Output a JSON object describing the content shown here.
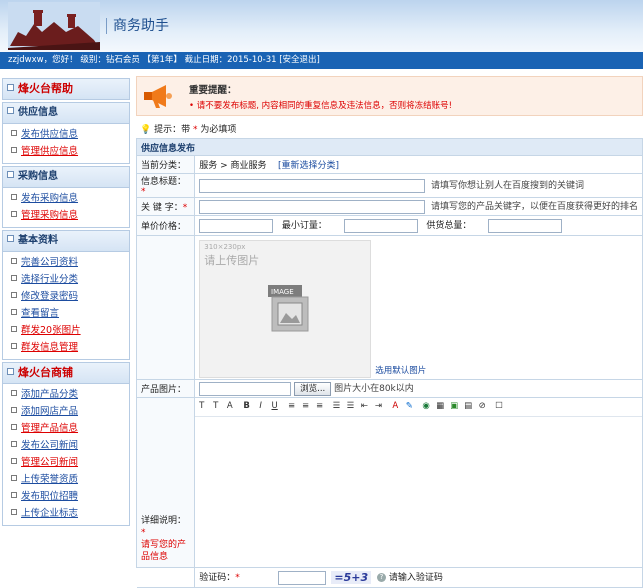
{
  "header": {
    "app_title": "商务助手"
  },
  "userbar": {
    "text": "zzjdwxw，您好！ 级别：钻石会员 【第1年】 截止日期：2015-10-31 [安全退出]"
  },
  "sidebar": {
    "sections": [
      {
        "title": "烽火台帮助",
        "style": "red",
        "items": []
      },
      {
        "title": "供应信息",
        "style": "blue",
        "items": [
          {
            "label": "发布供应信息",
            "red": false
          },
          {
            "label": "管理供应信息",
            "red": true
          }
        ]
      },
      {
        "title": "采购信息",
        "style": "blue",
        "items": [
          {
            "label": "发布采购信息",
            "red": false
          },
          {
            "label": "管理采购信息",
            "red": true
          }
        ]
      },
      {
        "title": "基本资料",
        "style": "blue",
        "items": [
          {
            "label": "完善公司资料",
            "red": false
          },
          {
            "label": "选择行业分类",
            "red": false
          },
          {
            "label": "修改登录密码",
            "red": false
          },
          {
            "label": "查看留言",
            "red": false
          },
          {
            "label": "群发20张图片",
            "red": true
          },
          {
            "label": "群发信息管理",
            "red": true
          }
        ]
      },
      {
        "title": "烽火台商铺",
        "style": "red",
        "items": [
          {
            "label": "添加产品分类",
            "red": false
          },
          {
            "label": "添加网店产品",
            "red": false
          },
          {
            "label": "管理产品信息",
            "red": true
          },
          {
            "label": "发布公司新闻",
            "red": false
          },
          {
            "label": "管理公司新闻",
            "red": true
          },
          {
            "label": "上传荣誉资质",
            "red": false
          },
          {
            "label": "发布职位招聘",
            "red": false
          },
          {
            "label": "上传企业标志",
            "red": false
          }
        ]
      }
    ]
  },
  "notice": {
    "title": "重要提醒：",
    "text": "• 请不要发布标题, 内容相同的重复信息及违法信息，否则将冻结账号!"
  },
  "tip": {
    "prefix": "提示：带",
    "star": "*",
    "suffix": "为必填项"
  },
  "form": {
    "section_title": "供应信息发布",
    "category": {
      "label": "当前分类：",
      "value": "服务 > 商业服务",
      "reselect": "[重新选择分类]"
    },
    "title_field": {
      "label": "信息标题：",
      "hint": "请填写你想让别人在百度搜到的关键词"
    },
    "keyword": {
      "label": "关 键 字：",
      "hint": "请填写您的产品关键字，以便在百度获得更好的排名"
    },
    "price": {
      "label": "单价价格：",
      "min_order": "最小订量：",
      "supply_total": "供货总量："
    },
    "image_placeholder": {
      "size": "310×230px",
      "text": "请上传图片",
      "icon_label": "IMAGE"
    },
    "default_image_link": "选用默认图片",
    "product_image": {
      "label": "产品图片：",
      "browse": "浏览...",
      "hint": "图片大小在80k以内"
    },
    "detail": {
      "label": "详细说明：",
      "sub": "请写您的产品信息"
    },
    "captcha": {
      "label": "验证码：",
      "code": "=5+3",
      "hint": "请输入验证码"
    }
  },
  "colors": {
    "userbar": "#1a63b4",
    "accent_red": "#dd0000",
    "link_blue": "#1d4da0"
  }
}
